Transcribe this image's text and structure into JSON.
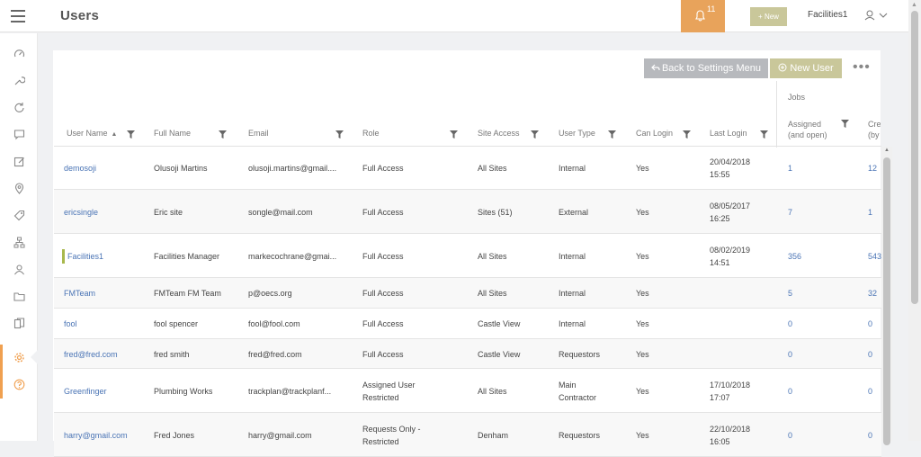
{
  "header": {
    "title": "Users",
    "notifications_count": "11",
    "new_button": "+ New",
    "user_name": "Facilities1"
  },
  "toolbar": {
    "back_button": "Back to Settings Menu",
    "new_user_button": "New User",
    "more": "•••"
  },
  "table": {
    "jobs_group": "Jobs",
    "columns": {
      "username": "User Name",
      "fullname": "Full Name",
      "email": "Email",
      "role": "Role",
      "site_access": "Site Access",
      "user_type": "User Type",
      "can_login": "Can Login",
      "last_login": "Last Login",
      "assigned_1": "Assigned",
      "assigned_2": "(and open)",
      "created_1": "Cre",
      "created_2": "(by"
    },
    "rows": [
      {
        "username": "demosoji",
        "fullname": "Olusoji Martins",
        "email": "olusoji.martins@gmail....",
        "role1": "Full Access",
        "role2": "",
        "site": "All Sites",
        "type1": "Internal",
        "type2": "",
        "login": "Yes",
        "last1": "20/04/2018",
        "last2": "15:55",
        "assigned": "1",
        "created": "12"
      },
      {
        "username": "ericsingle",
        "fullname": "Eric site",
        "email": "songle@mail.com",
        "role1": "Full Access",
        "role2": "",
        "site": "Sites (51)",
        "type1": "External",
        "type2": "",
        "login": "Yes",
        "last1": "08/05/2017",
        "last2": "16:25",
        "assigned": "7",
        "created": "1"
      },
      {
        "username": "Facilities1",
        "fullname": "Facilities Manager",
        "email": "markecochrane@gmai...",
        "role1": "Full Access",
        "role2": "",
        "site": "All Sites",
        "type1": "Internal",
        "type2": "",
        "login": "Yes",
        "last1": "08/02/2019",
        "last2": "14:51",
        "assigned": "356",
        "created": "543"
      },
      {
        "username": "FMTeam",
        "fullname": "FMTeam FM Team",
        "email": "p@oecs.org",
        "role1": "Full Access",
        "role2": "",
        "site": "All Sites",
        "type1": "Internal",
        "type2": "",
        "login": "Yes",
        "last1": "",
        "last2": "",
        "assigned": "5",
        "created": "32"
      },
      {
        "username": "fool",
        "fullname": "fool spencer",
        "email": "fool@fool.com",
        "role1": "Full Access",
        "role2": "",
        "site": "Castle View",
        "type1": "Internal",
        "type2": "",
        "login": "Yes",
        "last1": "",
        "last2": "",
        "assigned": "0",
        "created": "0"
      },
      {
        "username": "fred@fred.com",
        "fullname": "fred smith",
        "email": "fred@fred.com",
        "role1": "Full Access",
        "role2": "",
        "site": "Castle View",
        "type1": "Requestors",
        "type2": "",
        "login": "Yes",
        "last1": "",
        "last2": "",
        "assigned": "0",
        "created": "0"
      },
      {
        "username": "Greenfinger",
        "fullname": "Plumbing Works",
        "email": "trackplan@trackplanf...",
        "role1": "Assigned User",
        "role2": "Restricted",
        "site": "All Sites",
        "type1": "Main",
        "type2": "Contractor",
        "login": "Yes",
        "last1": "17/10/2018",
        "last2": "17:07",
        "assigned": "0",
        "created": "0"
      },
      {
        "username": "harry@gmail.com",
        "fullname": "Fred Jones",
        "email": "harry@gmail.com",
        "role1": "Requests Only -",
        "role2": "Restricted",
        "site": "Denham",
        "type1": "Requestors",
        "type2": "",
        "login": "Yes",
        "last1": "22/10/2018",
        "last2": "16:05",
        "assigned": "0",
        "created": "0"
      }
    ]
  },
  "colors": {
    "accent": "#e8a35b",
    "olive": "#c9c79a",
    "link": "#4a74b5",
    "marker": "#a8b84d"
  }
}
